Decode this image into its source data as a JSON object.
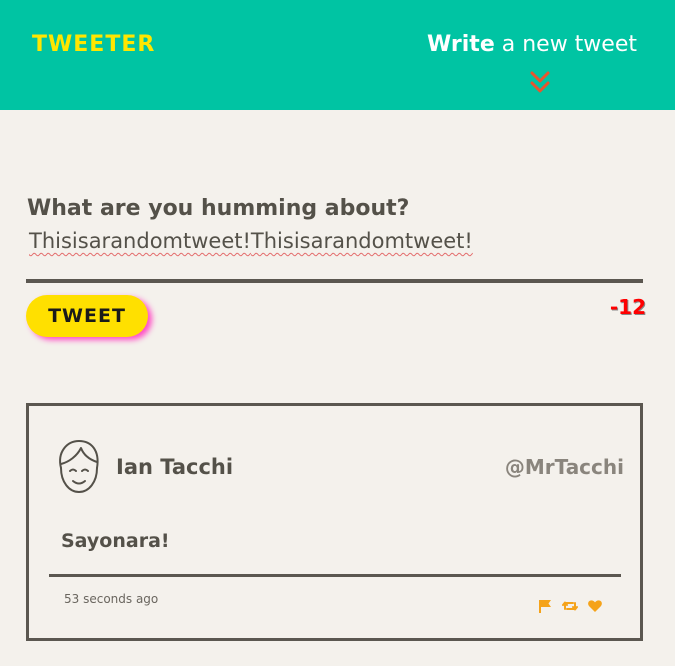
{
  "header": {
    "logo": "TWEETER",
    "compose_strong": "Write",
    "compose_rest": " a new tweet"
  },
  "composer": {
    "question": "What are you humming about?",
    "draft_words": [
      "Thisisarandomtweet!",
      "Thisisarandomtweet!"
    ],
    "button_label": "TWEET",
    "char_counter": "-12"
  },
  "tweet": {
    "author_name": "Ian Tacchi",
    "handle": "@MrTacchi",
    "text": "Sayonara!",
    "timestamp": "53 seconds ago"
  },
  "icons": {
    "chevron": "double-chevron-down-icon",
    "avatar": "user-avatar-icon",
    "flag": "flag-icon",
    "retweet": "retweet-icon",
    "like": "heart-icon"
  },
  "colors": {
    "header_bg": "#00c4a3",
    "logo": "#ffe600",
    "button_bg": "#ffe000",
    "button_shadow": "#ff4fc6",
    "counter_negative": "#ff0000",
    "action_icons": "#f5a31a",
    "chevron": "#e8552e",
    "page_bg": "#f4f1ec"
  }
}
